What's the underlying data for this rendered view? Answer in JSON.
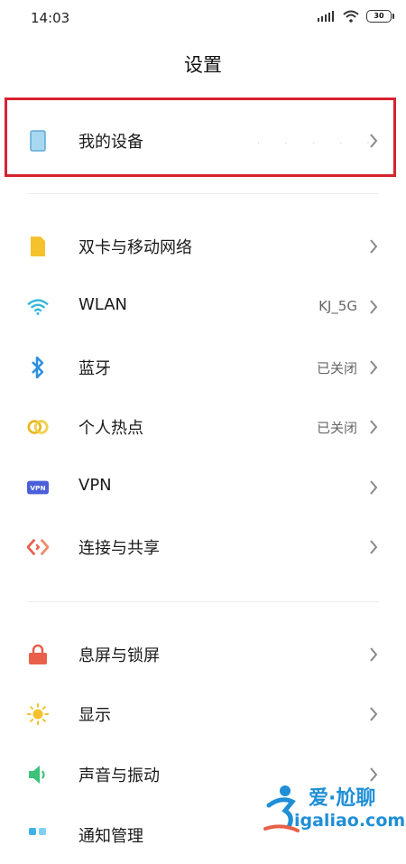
{
  "status_bar": {
    "time": "14:03",
    "battery": "30"
  },
  "page": {
    "title": "设置"
  },
  "watermark": {
    "cn": "爱·尬聊",
    "en": "igaliao.com"
  },
  "colors": {
    "accent_red": "#d7232f",
    "chevron": "#888888"
  },
  "sections": [
    {
      "items": [
        {
          "key": "my-device",
          "label": "我的设备",
          "value": "",
          "icon": "device-icon"
        }
      ]
    },
    {
      "items": [
        {
          "key": "sim-mobile-network",
          "label": "双卡与移动网络",
          "value": "",
          "icon": "sim-card-icon"
        },
        {
          "key": "wlan",
          "label": "WLAN",
          "value": "KJ_5G",
          "icon": "wifi-icon"
        },
        {
          "key": "bluetooth",
          "label": "蓝牙",
          "value": "已关闭",
          "icon": "bluetooth-icon"
        },
        {
          "key": "hotspot",
          "label": "个人热点",
          "value": "已关闭",
          "icon": "hotspot-icon"
        },
        {
          "key": "vpn",
          "label": "VPN",
          "value": "",
          "icon": "vpn-icon"
        },
        {
          "key": "connection-sharing",
          "label": "连接与共享",
          "value": "",
          "icon": "connection-sharing-icon"
        }
      ]
    },
    {
      "items": [
        {
          "key": "lock-screen",
          "label": "息屏与锁屏",
          "value": "",
          "icon": "lock-icon"
        },
        {
          "key": "display",
          "label": "显示",
          "value": "",
          "icon": "sun-icon"
        },
        {
          "key": "sound-vibration",
          "label": "声音与振动",
          "value": "",
          "icon": "speaker-icon"
        },
        {
          "key": "notifications",
          "label": "通知管理",
          "value": "",
          "icon": "notification-icon"
        }
      ]
    }
  ]
}
